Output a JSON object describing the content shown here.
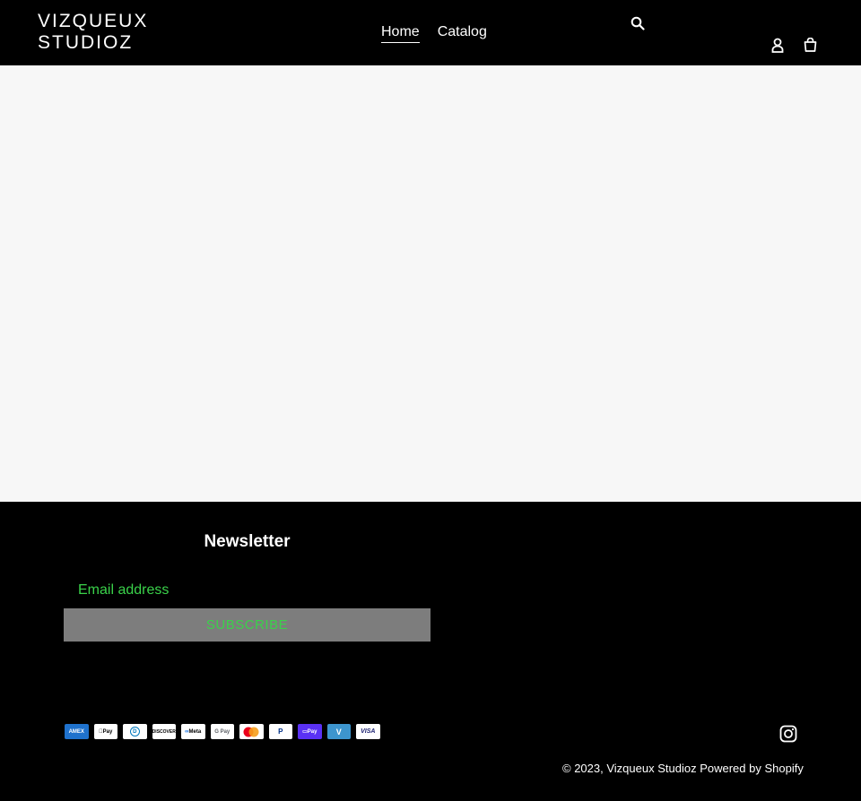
{
  "header": {
    "logo_line1": "VIZQUEUX",
    "logo_line2": "STUDIOZ",
    "nav": [
      {
        "label": "Home",
        "active": true
      },
      {
        "label": "Catalog",
        "active": false
      }
    ],
    "icons": {
      "search": "search-icon",
      "account": "user-icon",
      "cart": "cart-icon"
    }
  },
  "footer": {
    "newsletter_title": "Newsletter",
    "email_placeholder": "Email address",
    "subscribe_label": "SUBSCRIBE",
    "payments": [
      "AMEX",
      "Pay",
      "D",
      "DISCOVER",
      "Meta",
      "G Pay",
      "",
      "P",
      "Pay",
      "V",
      "VISA"
    ],
    "copyright_prefix": "© 2023,",
    "shop_name": "Vizqueux Studioz",
    "powered_by": "Powered by Shopify",
    "social_icon": "instagram-icon"
  },
  "colors": {
    "header_bg": "#000000",
    "main_bg": "#f7f7f7",
    "footer_bg": "#000000",
    "accent_text": "#3ad24a",
    "button_bg": "#7d7d7d"
  }
}
